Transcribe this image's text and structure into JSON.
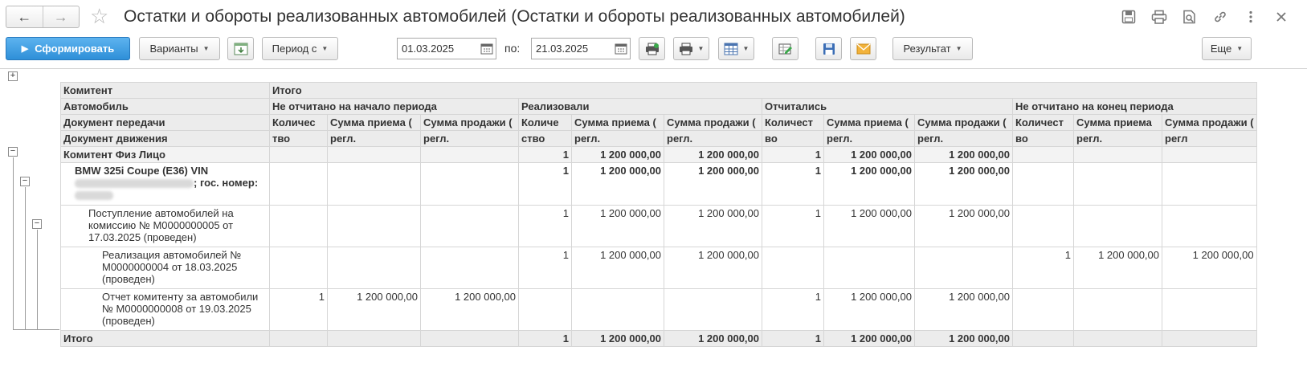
{
  "window": {
    "title": "Остатки и обороты реализованных автомобилей (Остатки и обороты реализованных автомобилей)"
  },
  "icons": {
    "back": "arrow-left-icon",
    "forward": "arrow-right-icon",
    "favorite": "star-icon",
    "save": "floppy-icon",
    "print": "printer-icon",
    "preview": "page-search-icon",
    "link": "link-icon",
    "more": "more-dots-icon",
    "close": "close-icon"
  },
  "toolbar": {
    "generate_label": "Сформировать",
    "variants_label": "Варианты",
    "period_label": "Период с",
    "date_from": "01.03.2025",
    "to_label": "по:",
    "date_to": "21.03.2025",
    "result_label": "Результат",
    "more_label": "Еще"
  },
  "report": {
    "header": {
      "row1": [
        "Комитент",
        "Итого"
      ],
      "row2": [
        "Автомобиль",
        "Не отчитано на начало периода",
        "Реализовали",
        "Отчитались",
        "Не отчитано на конец периода"
      ],
      "row3": [
        "Документ передачи",
        "Количес",
        "Сумма приема (",
        "Сумма продажи (",
        "Количе",
        "Сумма приема (",
        "Сумма продажи (",
        "Количест",
        "Сумма приема (",
        "Сумма продажи (",
        "Количест",
        "Сумма приема",
        "Сумма продажи ("
      ],
      "row4": [
        "Документ движения",
        "тво",
        "регл.",
        "регл.",
        "ство",
        "регл.",
        "регл.",
        "во",
        "регл.",
        "регл.",
        "во",
        "регл.",
        "регл"
      ]
    },
    "rows": [
      {
        "label": "Комитент Физ Лицо",
        "cells": [
          "",
          "",
          "",
          "1",
          "1 200 000,00",
          "1 200 000,00",
          "1",
          "1 200 000,00",
          "1 200 000,00",
          "",
          "",
          ""
        ]
      },
      {
        "label_line1": "BMW 325i Coupe (E36) VIN",
        "label_line2_suffix": "; гос. номер:",
        "cells": [
          "",
          "",
          "",
          "1",
          "1 200 000,00",
          "1 200 000,00",
          "1",
          "1 200 000,00",
          "1 200 000,00",
          "",
          "",
          ""
        ]
      },
      {
        "label": "Поступление автомобилей на комиссию № М0000000005 от 17.03.2025 (проведен)",
        "cells": [
          "",
          "",
          "",
          "1",
          "1 200 000,00",
          "1 200 000,00",
          "1",
          "1 200 000,00",
          "1 200 000,00",
          "",
          "",
          ""
        ]
      },
      {
        "label": "Реализация автомобилей № М0000000004 от 18.03.2025 (проведен)",
        "cells": [
          "",
          "",
          "",
          "1",
          "1 200 000,00",
          "1 200 000,00",
          "",
          "",
          "",
          "1",
          "1 200 000,00",
          "1 200 000,00"
        ]
      },
      {
        "label": "Отчет комитенту за автомобили № М0000000008 от 19.03.2025 (проведен)",
        "cells": [
          "1",
          "1 200 000,00",
          "1 200 000,00",
          "",
          "",
          "",
          "1",
          "1 200 000,00",
          "1 200 000,00",
          "",
          "",
          ""
        ]
      },
      {
        "label": "Итого",
        "cells": [
          "",
          "",
          "",
          "1",
          "1 200 000,00",
          "1 200 000,00",
          "1",
          "1 200 000,00",
          "1 200 000,00",
          "",
          "",
          ""
        ]
      }
    ]
  }
}
